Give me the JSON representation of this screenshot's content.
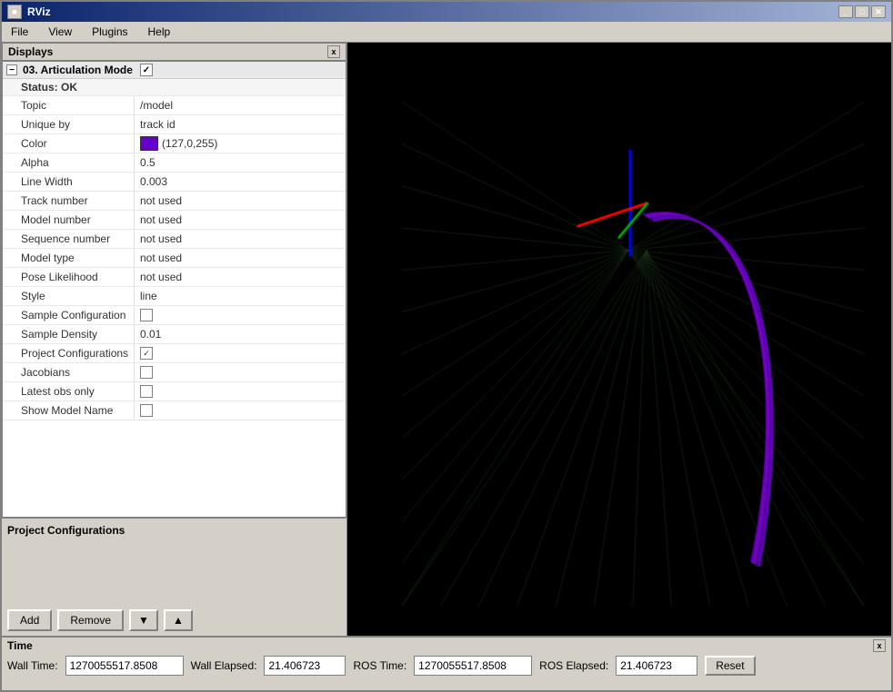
{
  "window": {
    "title": "RViz",
    "min_label": "_",
    "max_label": "□",
    "close_label": "✕"
  },
  "menu": {
    "items": [
      "File",
      "View",
      "Plugins",
      "Help"
    ]
  },
  "displays": {
    "header_label": "Displays",
    "close_label": "x",
    "tree_item_label": "03. Articulation Mode",
    "status_label": "Status: OK",
    "properties": [
      {
        "label": "Topic",
        "value": "/model"
      },
      {
        "label": "Unique by",
        "value": "track id"
      },
      {
        "label": "Color",
        "value": "(127,0,255)",
        "is_color": true,
        "color": "#7f00ff"
      },
      {
        "label": "Alpha",
        "value": "0.5"
      },
      {
        "label": "Line Width",
        "value": "0.003"
      },
      {
        "label": "Track number",
        "value": "not used"
      },
      {
        "label": "Model number",
        "value": "not used"
      },
      {
        "label": "Sequence number",
        "value": "not used"
      },
      {
        "label": "Model type",
        "value": "not used"
      },
      {
        "label": "Pose Likelihood",
        "value": "not used"
      },
      {
        "label": "Style",
        "value": "line"
      },
      {
        "label": "Sample Configuration",
        "value": "",
        "is_checkbox": true,
        "checked": false
      },
      {
        "label": "Sample Density",
        "value": "0.01"
      },
      {
        "label": "Project Configurations",
        "value": "",
        "is_checkbox": true,
        "checked": true
      },
      {
        "label": "Jacobians",
        "value": "",
        "is_checkbox": true,
        "checked": false
      },
      {
        "label": "Latest obs only",
        "value": "",
        "is_checkbox": true,
        "checked": false
      },
      {
        "label": "Show Model Name",
        "value": "",
        "is_checkbox": true,
        "checked": false
      }
    ],
    "bottom_panel_title": "Project Configurations",
    "buttons": {
      "add": "Add",
      "remove": "Remove",
      "down": "▼",
      "up": "▲"
    }
  },
  "time": {
    "header": "Time",
    "close_label": "x",
    "wall_time_label": "Wall Time:",
    "wall_time_value": "1270055517.8508",
    "wall_elapsed_label": "Wall Elapsed:",
    "wall_elapsed_value": "21.406723",
    "ros_time_label": "ROS Time:",
    "ros_time_value": "1270055517.8508",
    "ros_elapsed_label": "ROS Elapsed:",
    "ros_elapsed_value": "21.406723",
    "reset_label": "Reset"
  },
  "colors": {
    "axis_x": "#ff0000",
    "axis_y": "#00aa00",
    "axis_z": "#0000ff",
    "trajectory": "#6600cc",
    "grid": "#2a2a2a",
    "background": "#000000"
  },
  "icons": {
    "collapse": "−",
    "check": "✓",
    "minimize": "_",
    "maximize": "□",
    "close": "✕"
  }
}
